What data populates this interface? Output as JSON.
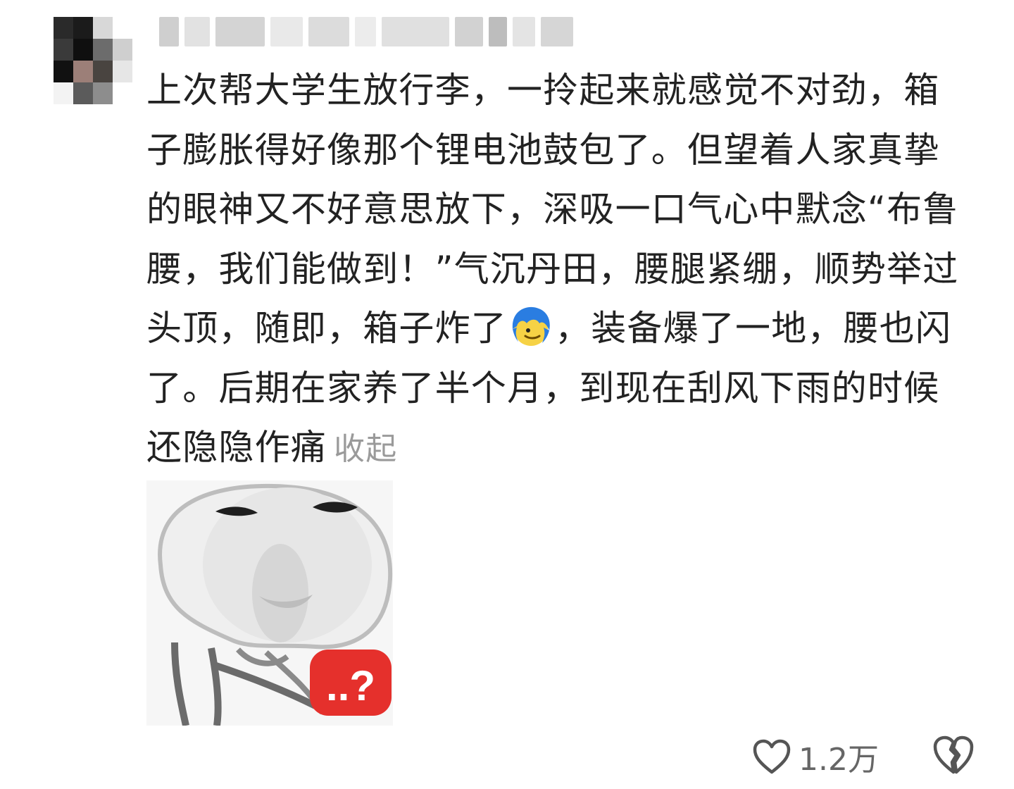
{
  "comment": {
    "username": "",
    "text": "上次帮大学生放行李，一拎起来就感觉不对劲，箱子膨胀得好像那个锂电池鼓包了。但望着人家真挚的眼神又不好意思放下，深吸一口气心中默念“布鲁腰，我们能做到！”气沉丹田，腰腿紧绷，顺势举过头顶，随即，箱子炸了",
    "text_after_emoji": "，装备爆了一地，腰也闪了。后期在家养了半个月，到现在刮风下雨的时候还隐隐作痛",
    "emoji_icon": "blue-hair-face-emoji-icon",
    "collapse_label": "收起",
    "sticker_badge": "..?",
    "likes": "1.2万",
    "like_icon": "heart-outline-icon",
    "dislike_icon": "broken-heart-icon"
  },
  "colors": {
    "text": "#222222",
    "muted": "#9a9a9a",
    "badge": "#e5302c"
  }
}
